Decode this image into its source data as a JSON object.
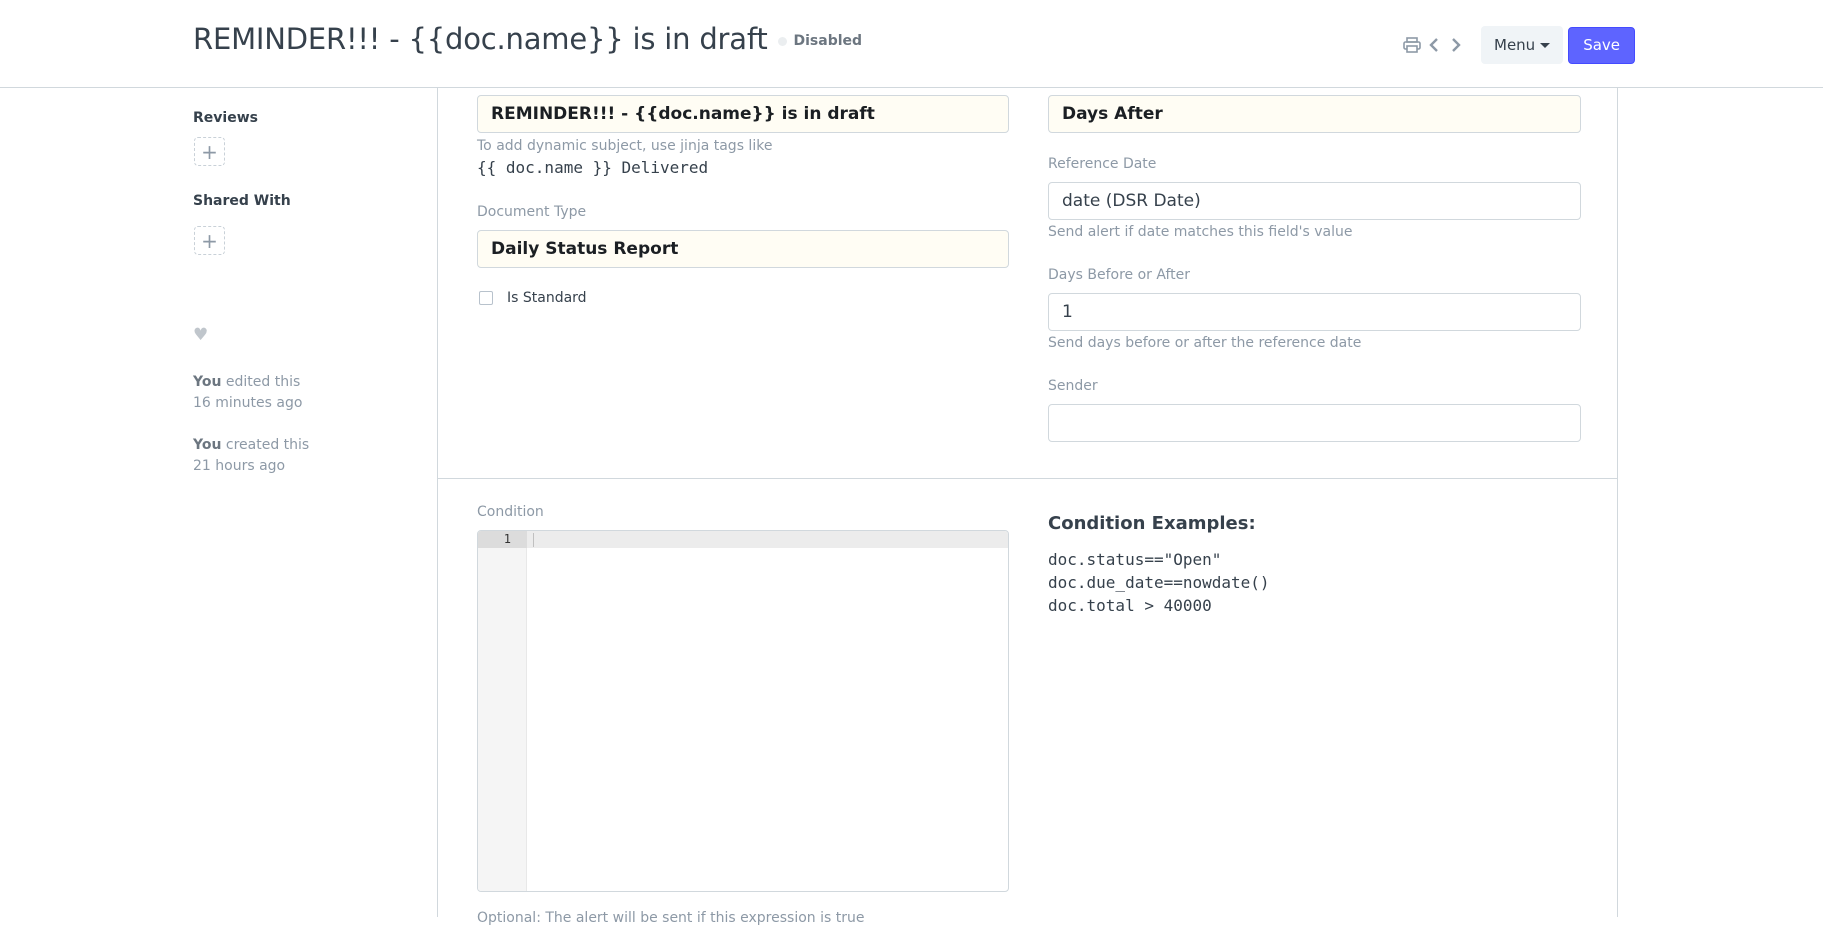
{
  "header": {
    "title": "REMINDER!!! - {{doc.name}} is in draft",
    "status": "Disabled",
    "menu_label": "Menu",
    "save_label": "Save"
  },
  "sidebar": {
    "reviews_label": "Reviews",
    "shared_with_label": "Shared With",
    "add_symbol": "+",
    "heart_symbol": "♥",
    "timeline": [
      {
        "actor": "You",
        "action": " edited this",
        "time": "16 minutes ago"
      },
      {
        "actor": "You",
        "action": " created this",
        "time": "21 hours ago"
      }
    ]
  },
  "form": {
    "subject": {
      "value": "REMINDER!!! - {{doc.name}} is in draft",
      "help": "To add dynamic subject, use jinja tags like",
      "example": "{{ doc.name }} Delivered"
    },
    "document_type": {
      "label": "Document Type",
      "value": "Daily Status Report"
    },
    "is_standard": {
      "label": "Is Standard",
      "checked": false
    },
    "send_alert_on": {
      "value": "Days After"
    },
    "reference_date": {
      "label": "Reference Date",
      "value": "date (DSR Date)",
      "help": "Send alert if date matches this field's value"
    },
    "days_before_or_after": {
      "label": "Days Before or After",
      "value": "1",
      "help": "Send days before or after the reference date"
    },
    "sender": {
      "label": "Sender",
      "value": ""
    },
    "condition": {
      "label": "Condition",
      "line_number": "1",
      "value": "",
      "help": "Optional: The alert will be sent if this expression is true"
    },
    "condition_examples": {
      "title": "Condition Examples:",
      "lines": [
        "doc.status==\"Open\"",
        "doc.due_date==nowdate()",
        "doc.total > 40000"
      ]
    }
  },
  "colors": {
    "primary": "#5e64ff",
    "border": "#d1d8dd",
    "text": "#36414c",
    "muted": "#8d99a6",
    "mandatory_bg": "#fffdf4"
  }
}
